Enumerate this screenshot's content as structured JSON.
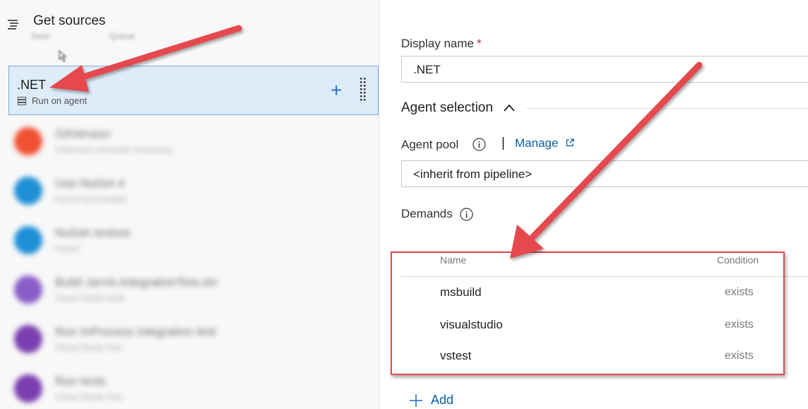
{
  "left_pane": {
    "get_sources": {
      "title": "Get sources",
      "ghost_buttons": [
        "Save",
        "Queue"
      ]
    },
    "job": {
      "name": ".NET",
      "subtitle": "Run on agent",
      "add_symbol": "+"
    },
    "tasks": [
      {
        "title": "GitVersion",
        "subtitle": "GitVersion semantic versioning",
        "color": "#f05133"
      },
      {
        "title": "Use NuGet 4",
        "subtitle": "NuGet tool installer",
        "color": "#1f8fd6"
      },
      {
        "title": "NuGet restore",
        "subtitle": "NuGet",
        "color": "#1f8fd6"
      },
      {
        "title": "Build Jarvis.IntegrationTest.sln",
        "subtitle": "Visual Studio build",
        "color": "#8a5dc8"
      },
      {
        "title": "Run InProcess integration test",
        "subtitle": "Visual Studio Test",
        "color": "#7b3fb0"
      },
      {
        "title": "Run tests",
        "subtitle": "Visual Studio Test",
        "color": "#7b3fb0"
      }
    ]
  },
  "right_pane": {
    "display_name": {
      "label": "Display name",
      "required_mark": "*",
      "value": ".NET"
    },
    "agent_selection": {
      "title": "Agent selection"
    },
    "agent_pool": {
      "label": "Agent pool",
      "separator": "|",
      "manage_link": "Manage",
      "value": "<inherit from pipeline>"
    },
    "demands": {
      "label": "Demands",
      "columns": {
        "name": "Name",
        "condition": "Condition"
      },
      "rows": [
        {
          "name": "msbuild",
          "condition": "exists"
        },
        {
          "name": "visualstudio",
          "condition": "exists"
        },
        {
          "name": "vstest",
          "condition": "exists"
        }
      ],
      "add_label": "Add"
    }
  },
  "colors": {
    "accent": "#2c72c7",
    "link": "#0a5fa5",
    "selected_bg": "#deecf9",
    "annotation_red": "#e5484d"
  },
  "icons": [
    "list-icon",
    "server-icon",
    "plus-icon",
    "drag-handle-icon",
    "chevron-up-icon",
    "info-icon",
    "external-link-icon"
  ]
}
